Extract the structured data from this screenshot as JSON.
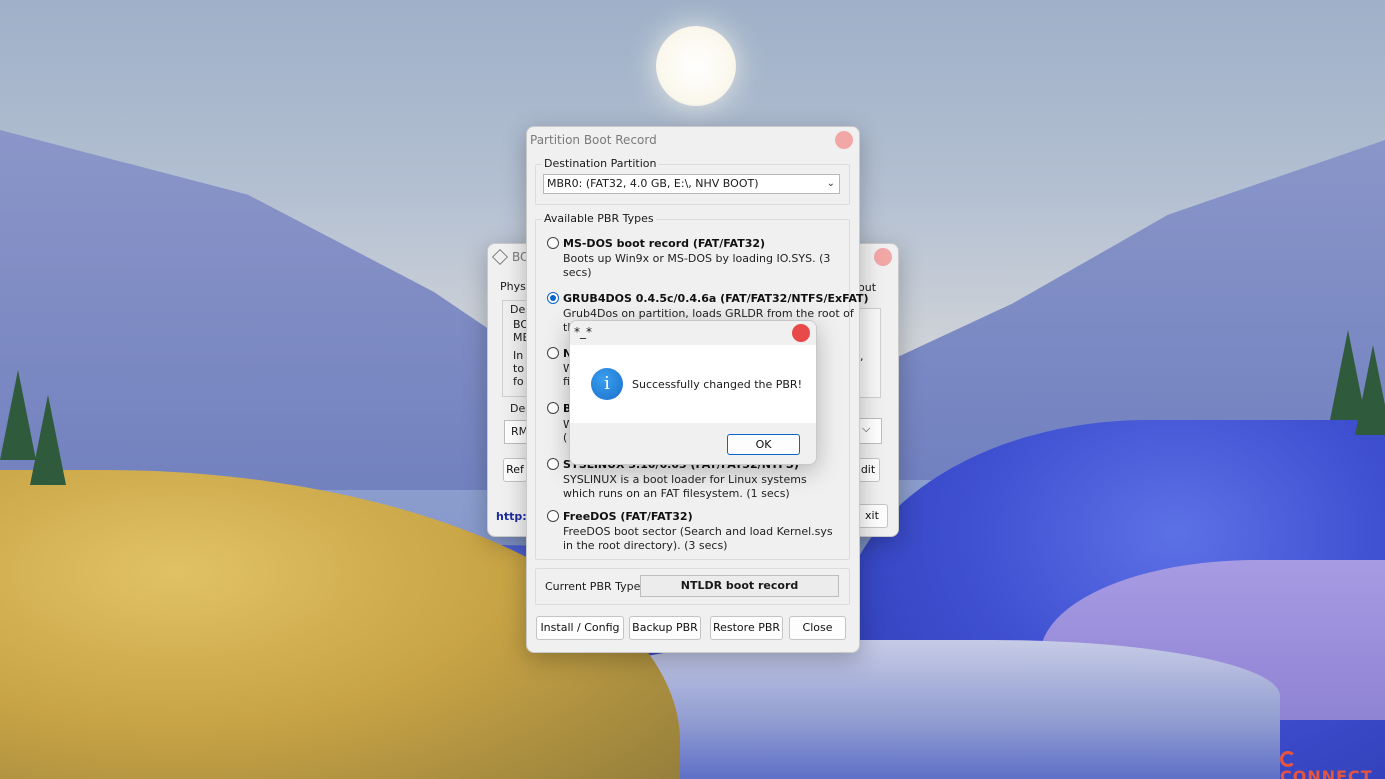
{
  "wallpaper": {
    "watermark": "CONNECT"
  },
  "bg_window": {
    "title": "BO",
    "tab_left": "Physi",
    "tab_right": "out",
    "frag_desc": "Des",
    "frag_line1": "BO",
    "frag_line2": "ME",
    "frag_line3": "In",
    "frag_line4": "to",
    "frag_line5": "fo",
    "frag_desc2": "Des",
    "frag_rm": "RM",
    "frag_ref": "Ref",
    "frag_http": "http:",
    "frag_edit": "dit",
    "frag_exit": "xit",
    "frag_right_comma": ",",
    "frag_chev": "⌵"
  },
  "pbr_window": {
    "title": "Partition Boot Record",
    "dest_group_label": "Destination Partition",
    "dest_select_value": "MBR0: (FAT32,   4.0 GB, E:\\, NHV BOOT)",
    "types_group_label": "Available PBR Types",
    "options": [
      {
        "title": "MS-DOS boot record (FAT/FAT32)",
        "desc": "Boots up Win9x or MS-DOS by loading IO.SYS. (3 secs)",
        "checked": false
      },
      {
        "title": "GRUB4DOS 0.4.5c/0.4.6a (FAT/FAT32/NTFS/ExFAT)",
        "desc": "Grub4Dos on partition, loads GRLDR from the root of",
        "checked": true
      },
      {
        "title": "N",
        "desc": "W",
        "desc2": "fi",
        "checked": false
      },
      {
        "title": "B",
        "desc": "W",
        "desc2": "(",
        "checked": false
      },
      {
        "title": "SYSLINUX 3.10/6.03 (FAT/FAT32/NTFS)",
        "desc": "SYSLINUX is a boot loader for Linux systems which runs on an FAT filesystem. (1 secs)",
        "checked": false
      },
      {
        "title": "FreeDOS (FAT/FAT32)",
        "desc": "FreeDOS boot sector (Search and load Kernel.sys in the root directory). (3 secs)",
        "checked": false
      }
    ],
    "opt2_partial": "th",
    "current_label": "Current PBR Type:",
    "current_value": "NTLDR boot record",
    "buttons": {
      "install": "Install / Config",
      "backup": "Backup PBR",
      "restore": "Restore PBR",
      "close": "Close"
    }
  },
  "message_box": {
    "title": "*_*",
    "icon": "info-icon",
    "text": "Successfully changed the PBR!",
    "ok": "OK"
  }
}
